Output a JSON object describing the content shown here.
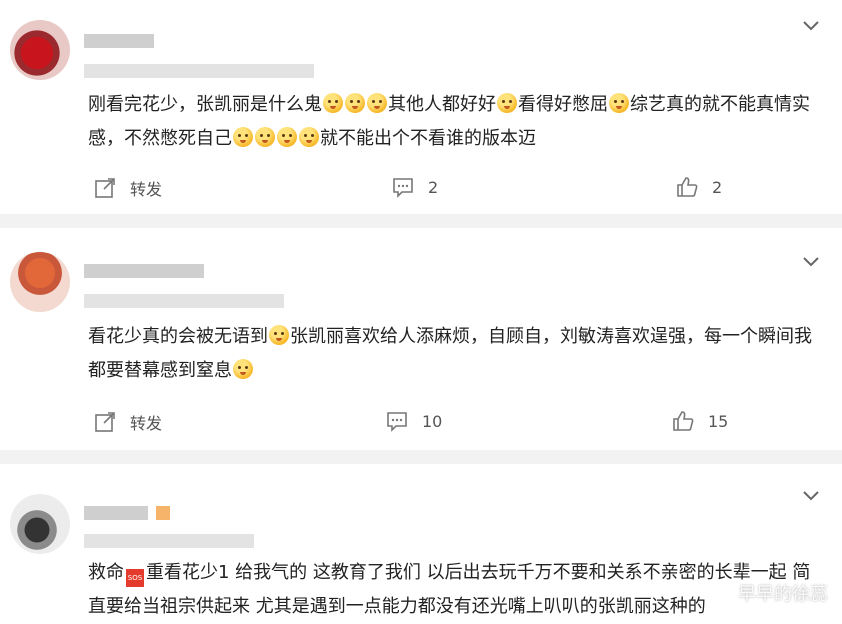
{
  "posts": [
    {
      "text_parts": [
        "刚看完花少，张凯丽是什么鬼",
        "其他人都好好",
        "看得好憋屈",
        "综艺真的就不能真情实感，不然憋死自己",
        "就不能出个不看谁的版本迈"
      ],
      "actions": {
        "repost_label": "转发",
        "comment_count": "2",
        "like_count": "2"
      }
    },
    {
      "text_parts": [
        "看花少真的会被无语到",
        "张凯丽喜欢给人添麻烦，自顾自，刘敏涛喜欢逞强，每一个瞬间我都要替幕感到窒息"
      ],
      "actions": {
        "repost_label": "转发",
        "comment_count": "10",
        "like_count": "15"
      }
    },
    {
      "text_parts": [
        "救命",
        "重看花少1 给我气的 这教育了我们 以后出去玩千万不要和关系不亲密的长辈一起 简直要给当祖宗供起来 尤其是遇到一点能力都没有还光嘴上叭叭的张凯丽这种的"
      ],
      "sos_label": "SOS",
      "actions": {}
    }
  ],
  "watermark": "早早的徐蕊"
}
